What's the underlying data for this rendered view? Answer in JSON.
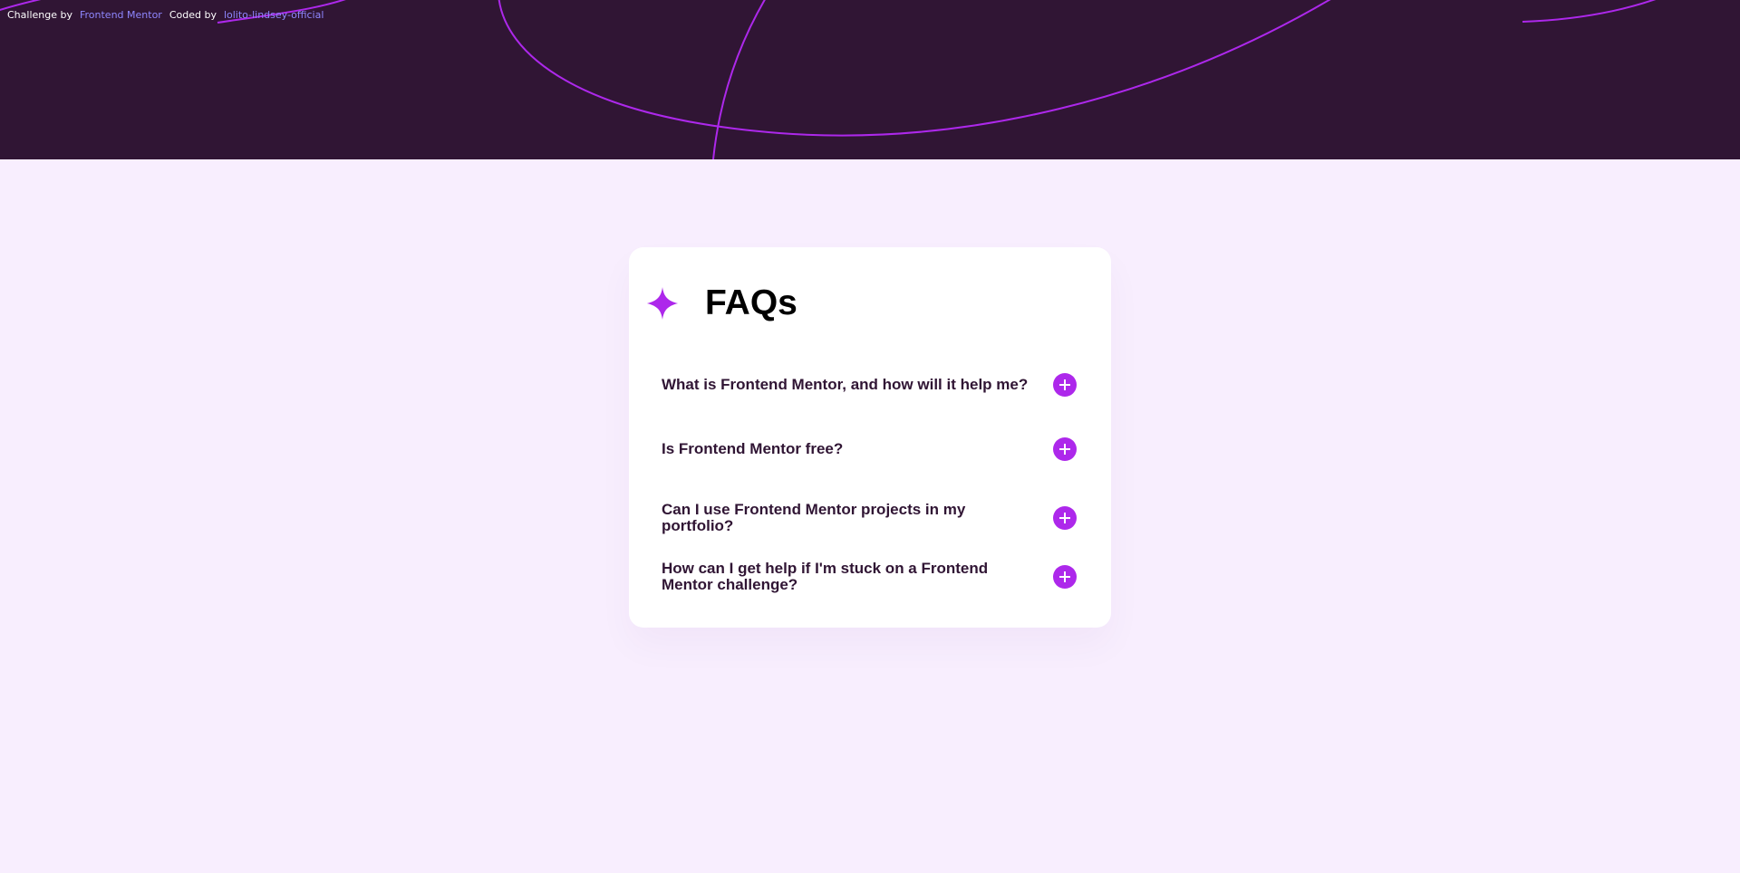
{
  "attribution": {
    "challenge_prefix": "Challenge by",
    "challenge_link": "Frontend Mentor",
    "coded_prefix": "Coded by",
    "coded_link": "lolito-lindsey-official"
  },
  "faq": {
    "title": "FAQs",
    "icon": "star-icon",
    "items": [
      {
        "question": "What is Frontend Mentor, and how will it help me?",
        "icon": "plus-icon"
      },
      {
        "question": "Is Frontend Mentor free?",
        "icon": "plus-icon"
      },
      {
        "question": "Can I use Frontend Mentor projects in my portfolio?",
        "icon": "plus-icon"
      },
      {
        "question": "How can I get help if I'm stuck on a Frontend Mentor challenge?",
        "icon": "plus-icon"
      }
    ]
  },
  "colors": {
    "page_background": "#f8eefe",
    "hero_background": "#301534",
    "accent": "#ad28eb",
    "question_text": "#301534",
    "link": "#8f87ff"
  }
}
